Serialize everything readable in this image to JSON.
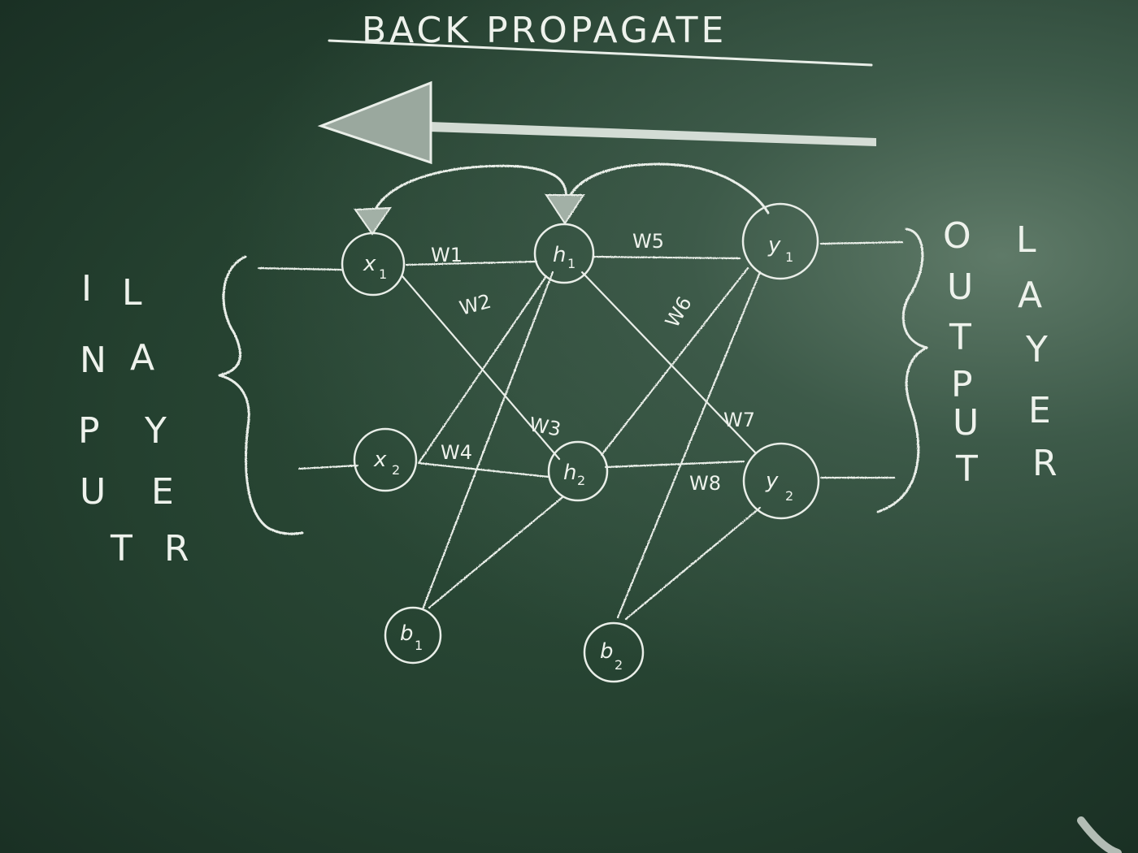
{
  "title": "BACK PROPAGATE",
  "input_layer_letters": {
    "col1": [
      "I",
      "N",
      "P",
      "U",
      "T"
    ],
    "col2": [
      "L",
      "A",
      "Y",
      "E",
      "R"
    ]
  },
  "output_layer_letters": {
    "col1": [
      "O",
      "U",
      "T",
      "P",
      "U",
      "T"
    ],
    "col2": [
      "L",
      "A",
      "Y",
      "E",
      "R"
    ]
  },
  "nodes": {
    "x1": {
      "main": "x",
      "sub": "1"
    },
    "x2": {
      "main": "x",
      "sub": "2"
    },
    "h1": {
      "main": "h",
      "sub": "1"
    },
    "h2": {
      "main": "h",
      "sub": "2"
    },
    "y1": {
      "main": "y",
      "sub": "1"
    },
    "y2": {
      "main": "y",
      "sub": "2"
    },
    "b1": {
      "main": "b",
      "sub": "1"
    },
    "b2": {
      "main": "b",
      "sub": "2"
    }
  },
  "weights": {
    "w1": "W1",
    "w2": "W2",
    "w3": "W3",
    "w4": "W4",
    "w5": "W5",
    "w6": "W6",
    "w7": "W7",
    "w8": "W8"
  },
  "colors": {
    "board": "#24402f",
    "chalk": "#e9eee8"
  }
}
